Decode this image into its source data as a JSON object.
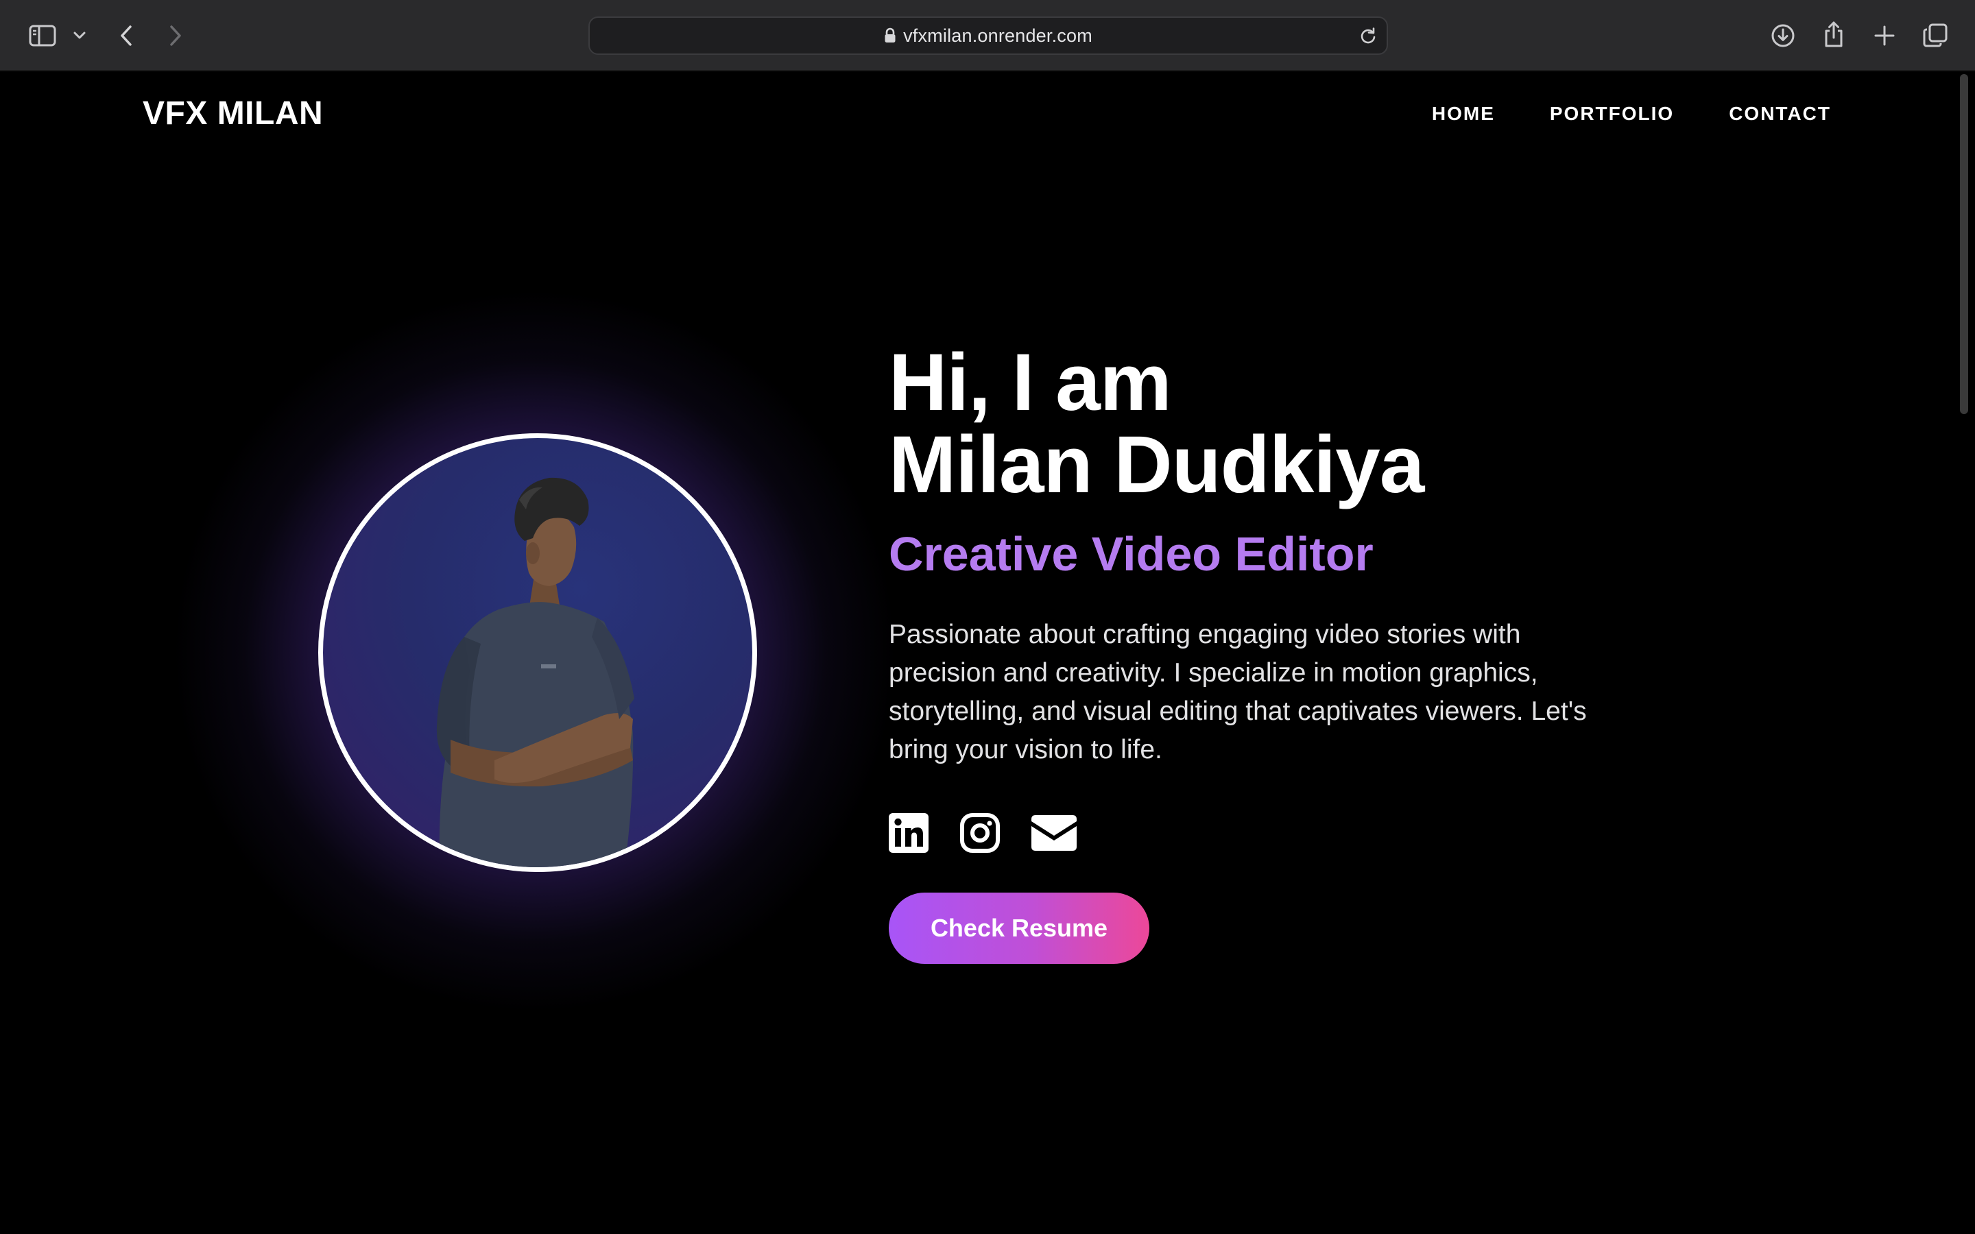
{
  "browser": {
    "url": "vfxmilan.onrender.com",
    "icons": [
      "sidebar-icon",
      "chevron-down-icon",
      "back-icon",
      "forward-icon",
      "lock-icon",
      "reload-icon",
      "download-icon",
      "share-icon",
      "new-tab-icon",
      "tabs-overview-icon"
    ]
  },
  "nav": {
    "brand": "VFX MILAN",
    "links": [
      "HOME",
      "PORTFOLIO",
      "CONTACT"
    ]
  },
  "hero": {
    "greeting": "Hi, I am",
    "name": "Milan Dudkiya",
    "role": "Creative Video Editor",
    "bio": "Passionate about crafting engaging video stories with precision and creativity. I specialize in motion graphics, storytelling, and visual editing that captivates viewers. Let's bring your vision to life.",
    "socials": [
      "linkedin-icon",
      "instagram-icon",
      "email-icon"
    ],
    "cta": "Check Resume"
  },
  "colors": {
    "accent": "#b57cf0",
    "button_gradient_start": "#a855f7",
    "button_gradient_end": "#ec4899",
    "background": "#000000"
  }
}
